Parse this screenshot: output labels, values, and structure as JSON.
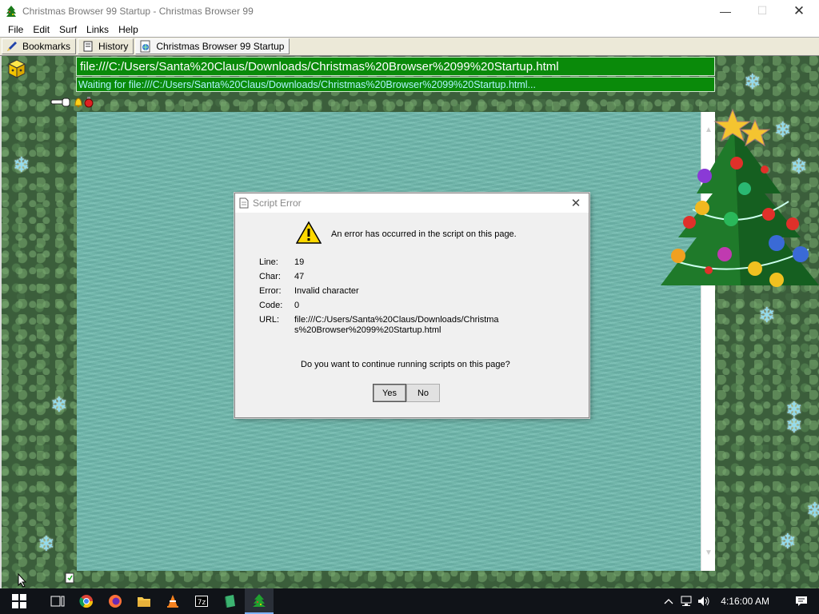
{
  "window": {
    "title": "Christmas Browser 99 Startup - Christmas Browser 99",
    "minimize_glyph": "—",
    "maximize_glyph": "☐",
    "close_glyph": "✕"
  },
  "menu": [
    {
      "label": "File"
    },
    {
      "label": "Edit"
    },
    {
      "label": "Surf"
    },
    {
      "label": "Links"
    },
    {
      "label": "Help"
    }
  ],
  "tabs": {
    "bookmarks": "Bookmarks",
    "history": "History",
    "current": "Christmas Browser 99 Startup"
  },
  "address": {
    "url": "file:///C:/Users/Santa%20Claus/Downloads/Christmas%20Browser%2099%20Startup.html",
    "status": "Waiting for file:///C:/Users/Santa%20Claus/Downloads/Christmas%20Browser%2099%20Startup.html..."
  },
  "dialog": {
    "title": "Script Error",
    "message": "An error has occurred in the script on this page.",
    "fields": {
      "line_label": "Line:",
      "line_value": "19",
      "char_label": "Char:",
      "char_value": "47",
      "error_label": "Error:",
      "error_value": "Invalid character",
      "code_label": "Code:",
      "code_value": "0",
      "url_label": "URL:",
      "url_value": "file:///C:/Users/Santa%20Claus/Downloads/Christmas%20Browser%2099%20Startup.html"
    },
    "question": "Do you want to continue running scripts on this page?",
    "yes_label": "Yes",
    "no_label": "No",
    "close_glyph": "✕"
  },
  "scroll": {
    "up": "▲",
    "down": "▼"
  },
  "snowflake": "❄",
  "taskbar": {
    "clock": "4:16:00 AM",
    "up_arrow": "^"
  },
  "colors": {
    "address_bg": "#0a8a0a",
    "status_text": "#aef4ff",
    "page_bg": "#6fb9ad",
    "forest": "#3b5e3b",
    "taskbar": "#101318"
  }
}
